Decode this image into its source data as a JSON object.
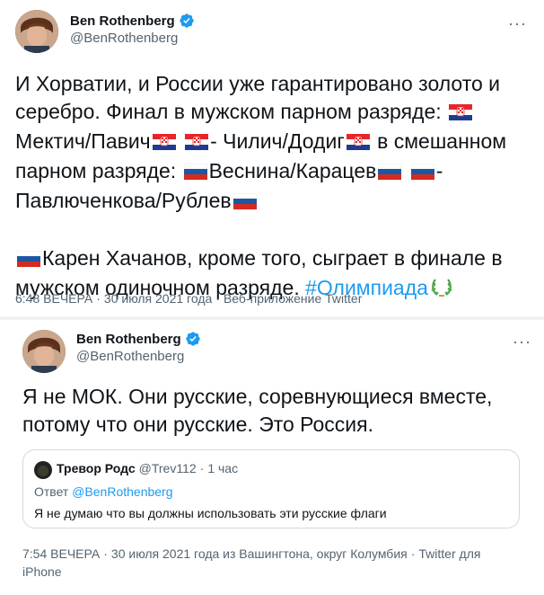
{
  "tweet1": {
    "author": {
      "name": "Ben Rothenberg",
      "handle": "@BenRothenberg",
      "verified": true
    },
    "text": {
      "p1_a": "И Хорватии, и России уже гарантировано золото и серебро. Финал в мужском парном разряде:",
      "p1_b": "Мектич/Павич",
      "p1_c": "- Чилич/Додиг",
      "p1_d": "в смешанном парном разряде:",
      "p1_e": "Веснина/Карацев",
      "p1_f": "- Павлюченкова/Рублев",
      "p2_a": "Карен Хачанов, кроме того, сыграет в финале в мужском одиночном разряде.",
      "hashtag": "#Олимпиада"
    },
    "meta": {
      "time": "6:48 ВЕЧЕРА",
      "date": "30 июля 2021 года",
      "source": "Веб-приложение Twitter"
    }
  },
  "tweet2": {
    "author": {
      "name": "Ben Rothenberg",
      "handle": "@BenRothenberg",
      "verified": true
    },
    "text": "Я не МОК. Они русские, соревнующиеся вместе, потому что они русские. Это Россия.",
    "quote": {
      "name": "Тревор Родс",
      "handle": "@Trev112",
      "time": "1 час",
      "reply_prefix": "Ответ",
      "reply_handle": "@BenRothenberg",
      "text": "Я не думаю что вы должны использовать эти русские флаги"
    },
    "meta": {
      "time": "7:54 ВЕЧЕРА",
      "date": "30 июля 2021 года из Вашингтона, округ Колумбия",
      "source": "Twitter для iPhone"
    }
  },
  "ui": {
    "more_label": "···",
    "separator": "·"
  },
  "flags": {
    "croatia": "croatia-flag",
    "russia": "russia-flag"
  },
  "colors": {
    "link": "#1d9bf0",
    "verified": "#1d9bf0",
    "muted": "#536471",
    "text": "#0f1419"
  }
}
